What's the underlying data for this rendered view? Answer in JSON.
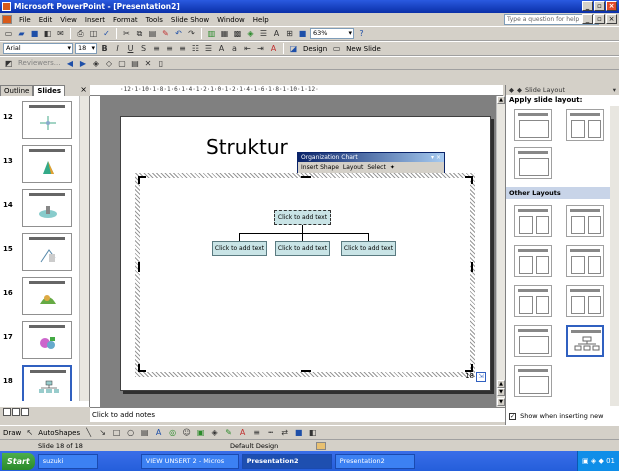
{
  "window": {
    "title": "Microsoft PowerPoint - [Presentation2]"
  },
  "menu": [
    "File",
    "Edit",
    "View",
    "Insert",
    "Format",
    "Tools",
    "Slide Show",
    "Window",
    "Help"
  ],
  "help_box": {
    "placeholder": "Type a question for help"
  },
  "toolbar2": {
    "zoom": "63%"
  },
  "toolbar3": {
    "font": "Arial",
    "size": "18",
    "design": "Design",
    "new_slide": "New Slide"
  },
  "toolbar4": {
    "reviewers": "Reviewers..."
  },
  "left_panel": {
    "tabs": [
      "Outline",
      "Slides"
    ],
    "slides": [
      "12",
      "13",
      "14",
      "15",
      "16",
      "17",
      "18"
    ]
  },
  "ruler": "·12·1·10·1·8·1·6·1·4·1·2·1·0·1·2·1·4·1·6·1·8·1·10·1·12·",
  "slide": {
    "title": "Struktur",
    "nodes": {
      "top": "Click to add text",
      "left": "Click to add text",
      "middle": "Click to add text",
      "right": "Click to add text"
    },
    "number": "18"
  },
  "org_chart": {
    "title": "Organization Chart",
    "insert_shape": "Insert Shape",
    "layout": "Layout",
    "select": "Select"
  },
  "notes": {
    "placeholder": "Click to add notes"
  },
  "task_pane": {
    "header": "Slide Layout",
    "apply": "Apply slide layout:",
    "other": "Other Layouts",
    "show_checkbox": "Show when inserting new slides"
  },
  "draw_bar": {
    "draw": "Draw",
    "autoshapes": "AutoShapes"
  },
  "status": {
    "slide": "Slide 18 of 18",
    "design": "Default Design"
  },
  "taskbar": {
    "start": "Start",
    "tasks": [
      "suzuki",
      "VIEW UNSERT 2 - Micros",
      "Presentation2",
      "Presentation2"
    ],
    "clock": "01"
  }
}
